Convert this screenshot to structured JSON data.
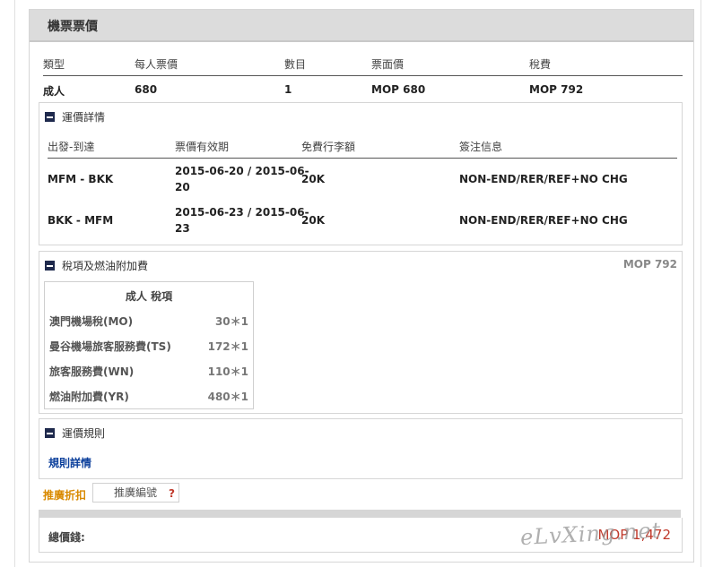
{
  "header": {
    "title": "機票票價"
  },
  "fare_table": {
    "columns": [
      "類型",
      "每人票價",
      "數目",
      "票面價",
      "稅費"
    ],
    "row": [
      "成人",
      "680",
      "1",
      "MOP 680",
      "MOP 792"
    ]
  },
  "fare_details": {
    "title": "運價詳情",
    "columns": [
      "出發-到達",
      "票價有效期",
      "免費行李額",
      "簽注信息"
    ],
    "rows": [
      {
        "route": "MFM - BKK",
        "validity_1": "2015-06-20 / 2015-06-",
        "validity_2": "20",
        "baggage": "20K",
        "endorsement": "NON-END/RER/REF+NO CHG"
      },
      {
        "route": "BKK - MFM",
        "validity_1": "2015-06-23 / 2015-06-",
        "validity_2": "23",
        "baggage": "20K",
        "endorsement": "NON-END/RER/REF+NO CHG"
      }
    ]
  },
  "taxes": {
    "title": "稅項及燃油附加費",
    "total": "MOP 792",
    "box_title": "成人 稅項",
    "items": [
      {
        "name": "澳門機場稅(MO)",
        "value": "30＊1"
      },
      {
        "name": "曼谷機場旅客服務費(TS)",
        "value": "172＊1"
      },
      {
        "name": "旅客服務費(WN)",
        "value": "110＊1"
      },
      {
        "name": "燃油附加費(YR)",
        "value": "480＊1"
      }
    ]
  },
  "fare_rules": {
    "title": "運價規則",
    "link": "規則詳情"
  },
  "promo": {
    "label": "推廣折扣",
    "placeholder": "推廣編號",
    "help": "?"
  },
  "total": {
    "label": "總價錢:",
    "value": "MOP 1,472"
  },
  "watermark": "eLvXing.net"
}
